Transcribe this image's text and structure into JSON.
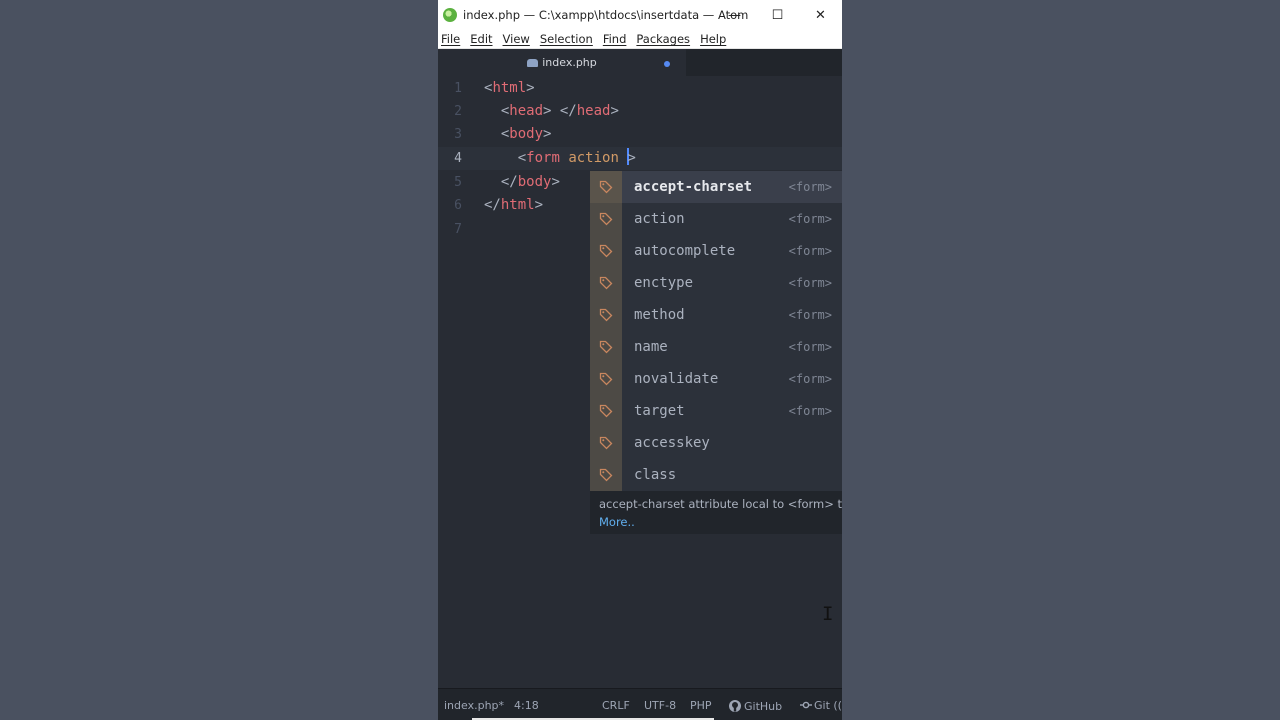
{
  "window": {
    "title": "index.php — C:\\xampp\\htdocs\\insertdata — Atom",
    "controls": {
      "minimize": "—",
      "maximize": "☐",
      "close": "✕"
    }
  },
  "menu": [
    "File",
    "Edit",
    "View",
    "Selection",
    "Find",
    "Packages",
    "Help"
  ],
  "tab": {
    "label": "index.php",
    "modified": true
  },
  "editor": {
    "line_numbers": [
      "1",
      "2",
      "3",
      "4",
      "5",
      "6",
      "7"
    ],
    "cursor_line": 4
  },
  "autocomplete": {
    "items": [
      {
        "label": "accept-charset",
        "right": "<form>",
        "selected": true
      },
      {
        "label": "action",
        "right": "<form>"
      },
      {
        "label": "autocomplete",
        "right": "<form>"
      },
      {
        "label": "enctype",
        "right": "<form>"
      },
      {
        "label": "method",
        "right": "<form>"
      },
      {
        "label": "name",
        "right": "<form>"
      },
      {
        "label": "novalidate",
        "right": "<form>"
      },
      {
        "label": "target",
        "right": "<form>"
      },
      {
        "label": "accesskey",
        "right": ""
      },
      {
        "label": "class",
        "right": ""
      }
    ],
    "description": "accept-charset attribute local to <form> tags",
    "more_link": "More.."
  },
  "statusbar": {
    "file": "index.php*",
    "position": "4:18",
    "line_ending": "CRLF",
    "encoding": "UTF-8",
    "grammar": "PHP",
    "github": "GitHub",
    "git": "Git (("
  },
  "colors": {
    "editor_bg": "#282c34",
    "tag": "#e06c75",
    "attribute": "#d19a66",
    "cursor": "#528bff",
    "link": "#61afef"
  }
}
